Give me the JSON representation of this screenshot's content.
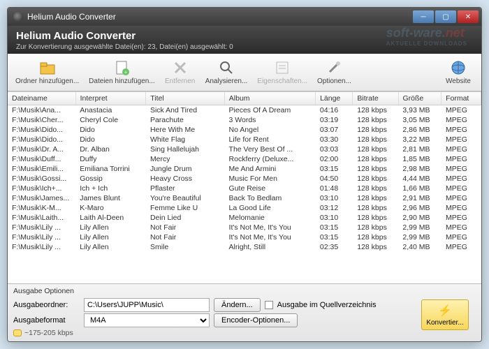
{
  "window": {
    "title": "Helium Audio Converter"
  },
  "header": {
    "title": "Helium Audio Converter",
    "status": "Zur Konvertierung ausgewählte Datei(en): 23, Datei(en) ausgewählt: 0"
  },
  "toolbar": {
    "add_folder": "Ordner hinzufügen...",
    "add_files": "Dateien hinzufügen...",
    "remove": "Entfernen",
    "analyze": "Analysieren...",
    "properties": "Eigenschaften...",
    "options": "Optionen...",
    "website": "Website"
  },
  "columns": [
    "Dateiname",
    "Interpret",
    "Titel",
    "Album",
    "Länge",
    "Bitrate",
    "Größe",
    "Format"
  ],
  "rows": [
    {
      "file": "F:\\Musik\\Ana...",
      "artist": "Anastacia",
      "title": "Sick And Tired",
      "album": "Pieces Of A Dream",
      "len": "04:16",
      "br": "128 kbps",
      "size": "3,93 MB",
      "fmt": "MPEG"
    },
    {
      "file": "F:\\Musik\\Cher...",
      "artist": "Cheryl Cole",
      "title": "Parachute",
      "album": "3 Words",
      "len": "03:19",
      "br": "128 kbps",
      "size": "3,05 MB",
      "fmt": "MPEG"
    },
    {
      "file": "F:\\Musik\\Dido...",
      "artist": "Dido",
      "title": "Here With Me",
      "album": "No Angel",
      "len": "03:07",
      "br": "128 kbps",
      "size": "2,86 MB",
      "fmt": "MPEG"
    },
    {
      "file": "F:\\Musik\\Dido...",
      "artist": "Dido",
      "title": "White Flag",
      "album": "Life for Rent",
      "len": "03:30",
      "br": "128 kbps",
      "size": "3,22 MB",
      "fmt": "MPEG"
    },
    {
      "file": "F:\\Musik\\Dr. A...",
      "artist": "Dr. Alban",
      "title": "Sing Hallelujah",
      "album": "The Very Best Of ...",
      "len": "03:03",
      "br": "128 kbps",
      "size": "2,81 MB",
      "fmt": "MPEG"
    },
    {
      "file": "F:\\Musik\\Duff...",
      "artist": "Duffy",
      "title": "Mercy",
      "album": "Rockferry (Deluxe...",
      "len": "02:00",
      "br": "128 kbps",
      "size": "1,85 MB",
      "fmt": "MPEG"
    },
    {
      "file": "F:\\Musik\\Emili...",
      "artist": "Emiliana Torrini",
      "title": "Jungle Drum",
      "album": "Me And Armini",
      "len": "03:15",
      "br": "128 kbps",
      "size": "2,98 MB",
      "fmt": "MPEG"
    },
    {
      "file": "F:\\Musik\\Gossi...",
      "artist": "Gossip",
      "title": "Heavy Cross",
      "album": "Music For Men",
      "len": "04:50",
      "br": "128 kbps",
      "size": "4,44 MB",
      "fmt": "MPEG"
    },
    {
      "file": "F:\\Musik\\Ich+...",
      "artist": "Ich + Ich",
      "title": "Pflaster",
      "album": "Gute Reise",
      "len": "01:48",
      "br": "128 kbps",
      "size": "1,66 MB",
      "fmt": "MPEG"
    },
    {
      "file": "F:\\Musik\\James...",
      "artist": "James Blunt",
      "title": "You're Beautiful",
      "album": "Back To Bedlam",
      "len": "03:10",
      "br": "128 kbps",
      "size": "2,91 MB",
      "fmt": "MPEG"
    },
    {
      "file": "F:\\Musik\\K-M...",
      "artist": "K-Maro",
      "title": "Femme Like U",
      "album": "La Good Life",
      "len": "03:12",
      "br": "128 kbps",
      "size": "2,96 MB",
      "fmt": "MPEG"
    },
    {
      "file": "F:\\Musik\\Laith...",
      "artist": "Laith Al-Deen",
      "title": "Dein Lied",
      "album": "Melomanie",
      "len": "03:10",
      "br": "128 kbps",
      "size": "2,90 MB",
      "fmt": "MPEG"
    },
    {
      "file": "F:\\Musik\\Lily ...",
      "artist": "Lily Allen",
      "title": "Not Fair",
      "album": "It's Not Me, It's You",
      "len": "03:15",
      "br": "128 kbps",
      "size": "2,99 MB",
      "fmt": "MPEG"
    },
    {
      "file": "F:\\Musik\\Lily ...",
      "artist": "Lily Allen",
      "title": "Not Fair",
      "album": "It's Not Me, It's You",
      "len": "03:15",
      "br": "128 kbps",
      "size": "2,99 MB",
      "fmt": "MPEG"
    },
    {
      "file": "F:\\Musik\\Lily ...",
      "artist": "Lily Allen",
      "title": "Smile",
      "album": "Alright, Still",
      "len": "02:35",
      "br": "128 kbps",
      "size": "2,40 MB",
      "fmt": "MPEG"
    }
  ],
  "output": {
    "group": "Ausgabe Optionen",
    "folder_label": "Ausgabeordner:",
    "folder_value": "C:\\Users\\JUPP\\Music\\",
    "change": "Ändern...",
    "source_dir": "Ausgabe im Quellverzeichnis",
    "format_label": "Ausgabeformat",
    "format_value": "M4A",
    "encoder": "Encoder-Optionen...",
    "hint": "~175-205 kbps"
  },
  "convert": "Konvertier...",
  "watermark": {
    "main": "soft-ware.",
    "net": "net",
    "sub": "AKTUELLE DOWNLOADS"
  }
}
